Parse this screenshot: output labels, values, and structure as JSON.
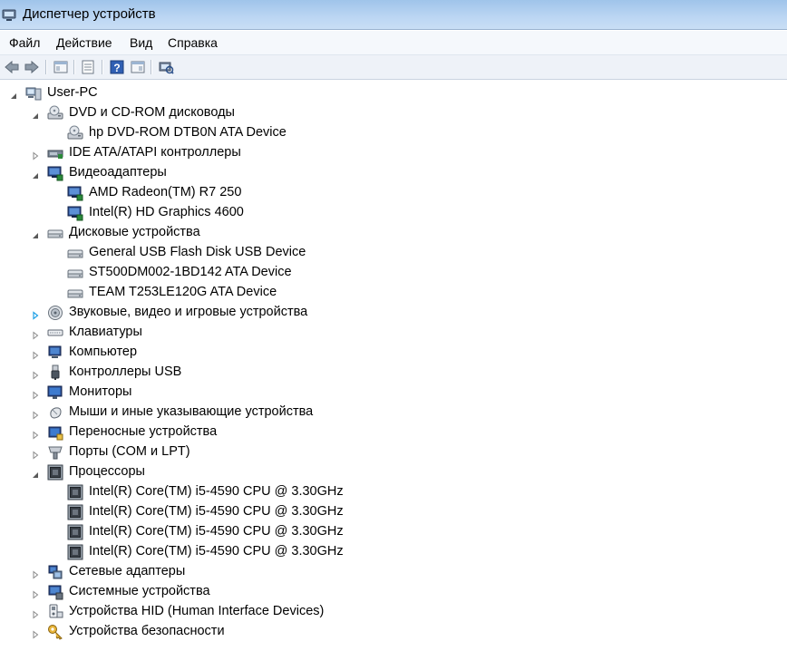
{
  "window": {
    "title": "Диспетчер устройств"
  },
  "menu": [
    "Файл",
    "Действие",
    "Вид",
    "Справка"
  ],
  "toolbar": [
    "back-icon",
    "forward-icon",
    "properties-panel-icon",
    "console-icon",
    "help-icon",
    "view-icon",
    "scan-hardware-icon"
  ],
  "tree": [
    {
      "label": "User-PC",
      "level": 0,
      "expanded": true,
      "icon": "computer-icon"
    },
    {
      "label": "DVD и CD-ROM дисководы",
      "level": 1,
      "expanded": true,
      "icon": "dvd-drive-icon"
    },
    {
      "label": "hp DVD-ROM DTB0N ATA Device",
      "level": 2,
      "icon": "dvd-drive-icon"
    },
    {
      "label": "IDE ATA/ATAPI контроллеры",
      "level": 1,
      "expanded": false,
      "icon": "ide-controller-icon"
    },
    {
      "label": "Видеоадаптеры",
      "level": 1,
      "expanded": true,
      "icon": "display-adapter-icon"
    },
    {
      "label": "AMD Radeon(TM) R7 250",
      "level": 2,
      "icon": "display-adapter-icon"
    },
    {
      "label": "Intel(R) HD Graphics 4600",
      "level": 2,
      "icon": "display-adapter-icon"
    },
    {
      "label": "Дисковые устройства",
      "level": 1,
      "expanded": true,
      "icon": "disk-drive-icon"
    },
    {
      "label": "General USB Flash Disk USB Device",
      "level": 2,
      "icon": "disk-drive-icon"
    },
    {
      "label": "ST500DM002-1BD142 ATA Device",
      "level": 2,
      "icon": "disk-drive-icon"
    },
    {
      "label": "TEAM T253LE120G ATA Device",
      "level": 2,
      "icon": "disk-drive-icon"
    },
    {
      "label": "Звуковые, видео и игровые устройства",
      "level": 1,
      "expanded": false,
      "highlight": true,
      "icon": "speaker-icon"
    },
    {
      "label": "Клавиатуры",
      "level": 1,
      "expanded": false,
      "icon": "keyboard-icon"
    },
    {
      "label": "Компьютер",
      "level": 1,
      "expanded": false,
      "icon": "computer-monitor-icon"
    },
    {
      "label": "Контроллеры USB",
      "level": 1,
      "expanded": false,
      "icon": "usb-icon"
    },
    {
      "label": "Мониторы",
      "level": 1,
      "expanded": false,
      "icon": "monitor-icon"
    },
    {
      "label": "Мыши и иные указывающие устройства",
      "level": 1,
      "expanded": false,
      "icon": "mouse-icon"
    },
    {
      "label": "Переносные устройства",
      "level": 1,
      "expanded": false,
      "icon": "portable-device-icon"
    },
    {
      "label": "Порты (COM и LPT)",
      "level": 1,
      "expanded": false,
      "icon": "port-icon"
    },
    {
      "label": "Процессоры",
      "level": 1,
      "expanded": true,
      "icon": "processor-icon"
    },
    {
      "label": "Intel(R) Core(TM) i5-4590 CPU @ 3.30GHz",
      "level": 2,
      "icon": "processor-icon"
    },
    {
      "label": "Intel(R) Core(TM) i5-4590 CPU @ 3.30GHz",
      "level": 2,
      "icon": "processor-icon"
    },
    {
      "label": "Intel(R) Core(TM) i5-4590 CPU @ 3.30GHz",
      "level": 2,
      "icon": "processor-icon"
    },
    {
      "label": "Intel(R) Core(TM) i5-4590 CPU @ 3.30GHz",
      "level": 2,
      "icon": "processor-icon"
    },
    {
      "label": "Сетевые адаптеры",
      "level": 1,
      "expanded": false,
      "icon": "network-adapter-icon"
    },
    {
      "label": "Системные устройства",
      "level": 1,
      "expanded": false,
      "icon": "system-device-icon"
    },
    {
      "label": "Устройства HID (Human Interface Devices)",
      "level": 1,
      "expanded": false,
      "icon": "hid-icon"
    },
    {
      "label": "Устройства безопасности",
      "level": 1,
      "expanded": false,
      "icon": "security-device-icon"
    }
  ]
}
